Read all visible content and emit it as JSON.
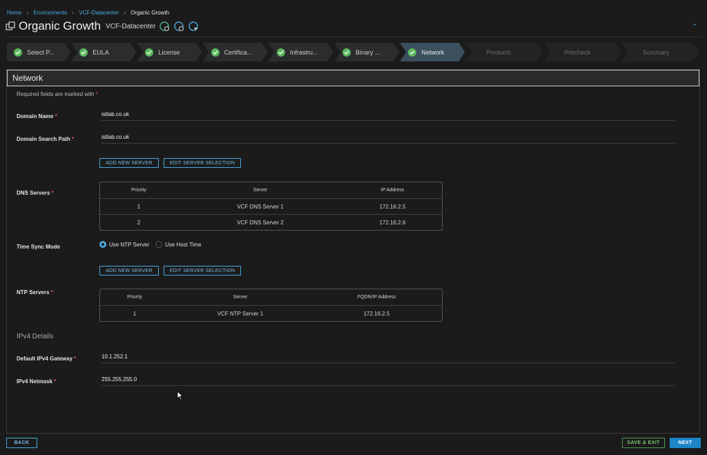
{
  "breadcrumb": [
    "Home",
    "Environments",
    "VCF-Datacenter",
    "Organic Growth"
  ],
  "header": {
    "title": "Organic Growth",
    "subtitle": "VCF-Datacenter"
  },
  "stepper": {
    "steps": [
      {
        "label": "Select P...",
        "state": "done"
      },
      {
        "label": "EULA",
        "state": "done"
      },
      {
        "label": "License",
        "state": "done"
      },
      {
        "label": "Certifica...",
        "state": "done"
      },
      {
        "label": "Infrastru...",
        "state": "done"
      },
      {
        "label": "Binary ...",
        "state": "done"
      },
      {
        "label": "Network",
        "state": "active"
      },
      {
        "label": "Products",
        "state": "future"
      },
      {
        "label": "Precheck",
        "state": "future"
      },
      {
        "label": "Summary",
        "state": "future"
      }
    ]
  },
  "panel": {
    "title": "Network",
    "required_note": "Required fields are marked with",
    "required_star": "*"
  },
  "form": {
    "domain_name_label": "Domain Name",
    "domain_name_value": "istlab.co.uk",
    "domain_search_path_label": "Domain Search Path",
    "domain_search_path_value": "istlab.co.uk",
    "dns_servers_label": "DNS Servers",
    "time_sync_label": "Time Sync Mode",
    "ntp_servers_label": "NTP Servers",
    "ipv4_section": "IPv4 Details",
    "gateway_label": "Default IPv4 Gateway",
    "gateway_value": "10.1.252.1",
    "netmask_label": "IPv4 Netmask",
    "netmask_value": "255.255.255.0",
    "star": "*"
  },
  "buttons": {
    "add_new_server": "ADD NEW SERVER",
    "edit_server_selection": "EDIT SERVER SELECTION",
    "back": "BACK",
    "save_exit": "SAVE & EXIT",
    "next": "NEXT"
  },
  "dns_grid": {
    "headers": [
      "Priority",
      "Server",
      "IP Address"
    ],
    "rows": [
      [
        "1",
        "VCF DNS Server 1",
        "172.16.2.5"
      ],
      [
        "2",
        "VCF DNS Server 2",
        "172.16.2.6"
      ]
    ]
  },
  "ntp_grid": {
    "headers": [
      "Priority",
      "Server",
      "FQDN/IP Address"
    ],
    "rows": [
      [
        "1",
        "VCF NTP Server 1",
        "172.16.2.5"
      ]
    ]
  },
  "time_sync": {
    "options": [
      "Use NTP Server",
      "Use Host Time"
    ],
    "selected": "Use NTP Server"
  },
  "colors": {
    "accent": "#4aa8e0",
    "success": "#5cb85c",
    "required": "#e05252",
    "background": "#1b1b1b"
  }
}
